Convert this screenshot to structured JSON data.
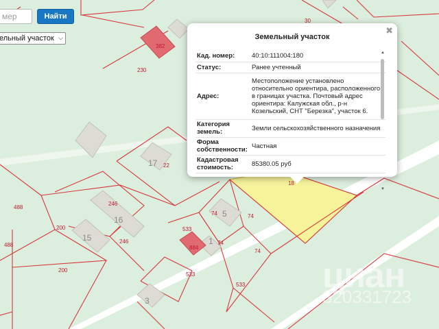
{
  "search": {
    "placeholder": "мер",
    "button_label": "Найти"
  },
  "layer_select": {
    "selected": "ельный участок"
  },
  "map_labels": {
    "plot_numbers": [
      "30",
      "382",
      "230",
      "22",
      "488",
      "246",
      "200",
      "246",
      "488",
      "200",
      "533",
      "74",
      "74",
      "884",
      "74",
      "74",
      "533",
      "533",
      "18"
    ],
    "house_numbers": [
      "17",
      "16",
      "15",
      "5",
      "1",
      "3"
    ]
  },
  "popup": {
    "title": "Земельный участок",
    "rows": [
      {
        "key": "Кад. номер:",
        "value": "40:10:111004:180"
      },
      {
        "key": "Статус:",
        "value": "Ранее учтенный"
      },
      {
        "key": "Адрес:",
        "value": "Местоположение установлено относительно ориентира, расположенного в границах участка. Почтовый адрес ориентира: Калужская обл., р-н Козельский, СНТ \"Березка\", участок 6."
      },
      {
        "key": "Категория земель:",
        "value": "Земли сельскохозяйственного назначения"
      },
      {
        "key": "Форма собственности:",
        "value": "Частная"
      },
      {
        "key": "Кадастровая стоимость:",
        "value": "85380.05 руб"
      }
    ]
  },
  "colors": {
    "map_bg": "#dceedd",
    "plot_border": "#d8373d",
    "selected_fill": "#f6f39a",
    "highlight_building": "#e06a70",
    "button_bg": "#1a78c3"
  },
  "watermark": {
    "text": "циан",
    "id": "320331723"
  },
  "icons": {
    "close": "close-icon",
    "chevron": "chevron-down-icon"
  }
}
